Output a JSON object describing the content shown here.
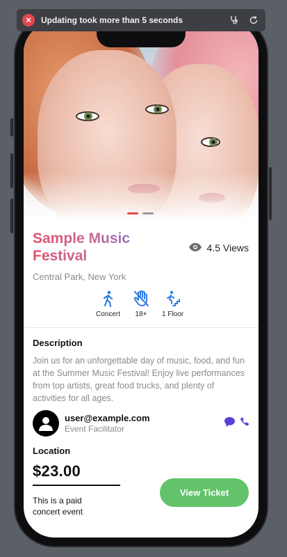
{
  "banner": {
    "message": "Updating took more than 5 seconds",
    "status_color": "#e5484d",
    "icons": [
      "error-icon",
      "stethoscope-icon",
      "reload-icon"
    ]
  },
  "event": {
    "title": "Sample Music Festival",
    "views": "4.5 Views",
    "location": "Central Park, New York",
    "carousel": {
      "total": 2,
      "active": 1
    },
    "features": [
      {
        "label": "Concert",
        "icon": "person-walking-icon"
      },
      {
        "label": "18+",
        "icon": "no-hand-icon"
      },
      {
        "label": "1 Floor",
        "icon": "stairs-icon"
      }
    ],
    "description_heading": "Description",
    "description": "Join us for an unforgettable day of music, food, and fun at the Summer Music Festival! Enjoy live performances from top artists, great food trucks, and plenty of activities for all ages.",
    "host": {
      "email": "user@example.com",
      "role": "Event Facilitator"
    },
    "location_heading": "Location",
    "price": "$23.00",
    "note": "This is a paid concert event",
    "button_label": "View Ticket"
  },
  "colors": {
    "accent_blue": "#2f7de1",
    "button_green": "#62c36a",
    "chat_purple": "#5b3fd6"
  }
}
